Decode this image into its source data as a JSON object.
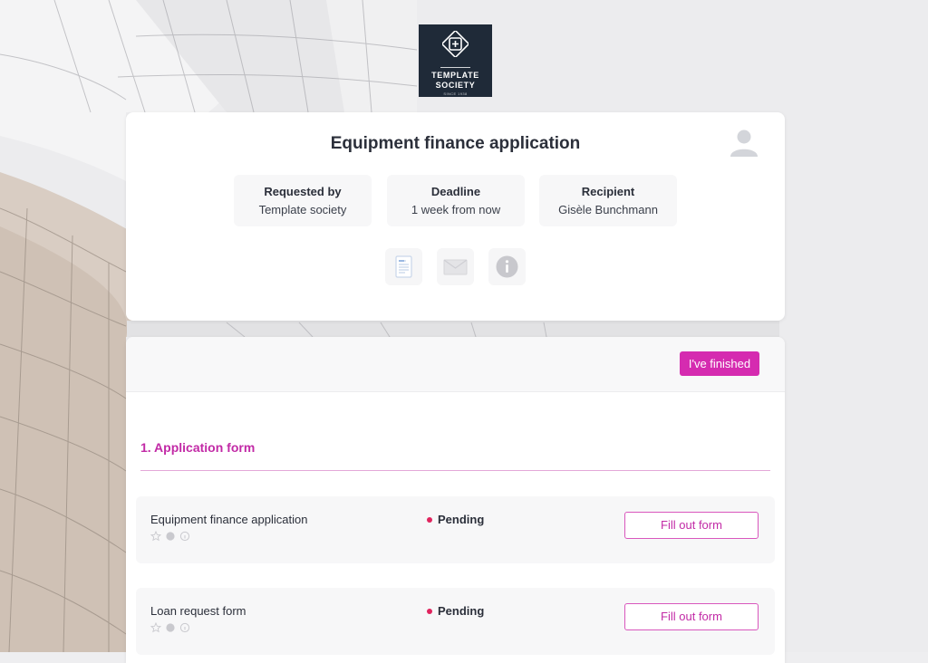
{
  "brand": {
    "line1": "TEMPLATE",
    "line2": "SOCIETY",
    "line3": "SINCE 1938"
  },
  "request": {
    "title": "Equipment finance application",
    "info": [
      {
        "label": "Requested by",
        "value": "Template society"
      },
      {
        "label": "Deadline",
        "value": "1 week from now"
      },
      {
        "label": "Recipient",
        "value": "Gisèle Bunchmann"
      }
    ],
    "icons": [
      "document-icon",
      "mail-icon",
      "info-icon"
    ]
  },
  "panel": {
    "finish_label": "I've finished",
    "section_title": "1. Application form",
    "forms": [
      {
        "name": "Equipment finance application",
        "status": "Pending",
        "action": "Fill out form"
      },
      {
        "name": "Loan request form",
        "status": "Pending",
        "action": "Fill out form"
      }
    ]
  },
  "colors": {
    "accent": "#d52bb0",
    "status_pending": "#e0245e",
    "logo_bg": "#1f2a38"
  }
}
